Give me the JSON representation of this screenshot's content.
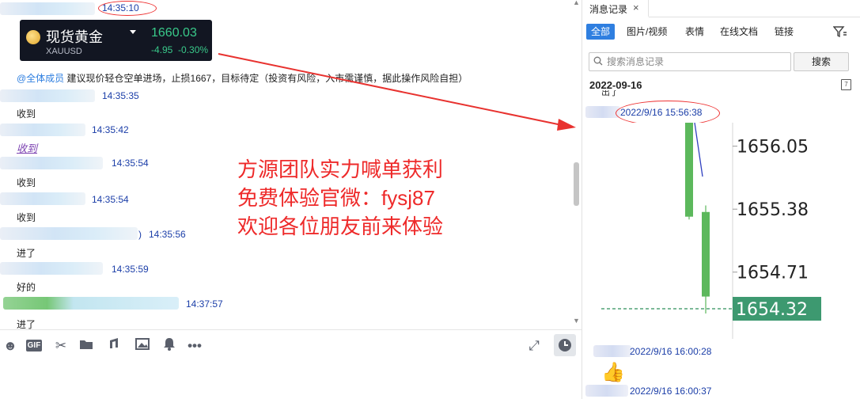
{
  "chat": {
    "messages": [
      {
        "time": "14:35:10"
      },
      {
        "time": "14:35:35",
        "text": "收到"
      },
      {
        "time": "14:35:42",
        "text": "收到"
      },
      {
        "time": "14:35:54",
        "text": "收到"
      },
      {
        "time": "14:35:54",
        "text": "收到"
      },
      {
        "time": "14:35:56",
        "text": "进了"
      },
      {
        "time": "14:35:59",
        "text": "好的"
      },
      {
        "time": "14:37:57",
        "text": "进了"
      }
    ],
    "announcement": {
      "mention": "@全体成员",
      "text": "建议现价轻仓空单进场，止损1667，目标待定（投资有风险，入市需谨慎，据此操作风险自担）"
    },
    "partial_paren": ")"
  },
  "quote_card": {
    "name": "现货黄金",
    "symbol": "XAUUSD",
    "price": "1660.03",
    "change": "-4.95",
    "change_pct": "-0.30%"
  },
  "promo": {
    "line1": "方源团队实力喊单获利",
    "line2": "免费体验官微：fysj87",
    "line3": "欢迎各位朋友前来体验"
  },
  "toolbar": {
    "icons": [
      "emoji-icon",
      "gif-icon",
      "scissors-icon",
      "folder-icon",
      "music-icon",
      "image-icon",
      "bell-icon",
      "more-icon",
      "expand-icon",
      "history-icon"
    ],
    "gif_label": "GIF"
  },
  "history": {
    "tab_label": "消息记录",
    "filters": [
      "全部",
      "图片/视频",
      "表情",
      "在线文档",
      "链接"
    ],
    "search": {
      "placeholder": "搜索消息记录",
      "button": "搜索"
    },
    "date": "2022-09-16",
    "entries": [
      {
        "time": "2022/9/16 15:56:38"
      },
      {
        "time": "2022/9/16 16:00:28"
      },
      {
        "time": "2022/9/16 16:00:37"
      }
    ],
    "cut_text": "出了"
  },
  "chart_data": {
    "type": "candlestick",
    "y_ticks": [
      "1656.05",
      "1655.38",
      "1654.71"
    ],
    "last_price": "1654.32",
    "ylim": [
      1654.0,
      1656.3
    ],
    "candles": [
      {
        "open": 1656.3,
        "close": 1655.3,
        "high": 1656.3,
        "low": 1655.27,
        "color": "#5cb85c"
      },
      {
        "open": 1655.35,
        "close": 1654.45,
        "high": 1655.42,
        "low": 1654.27,
        "color": "#5cb85c"
      }
    ],
    "current_line": 1654.32,
    "colors": {
      "candle": "#5cb85c",
      "price_tag": "#3d9970",
      "dashed": "#2f8f5b"
    }
  }
}
